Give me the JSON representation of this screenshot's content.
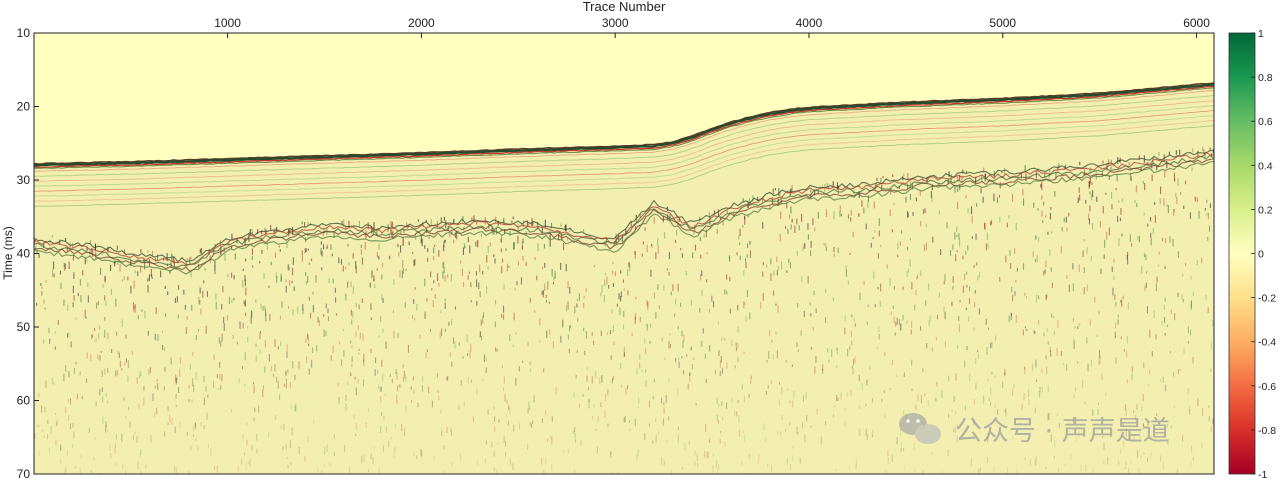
{
  "chart_data": {
    "type": "heatmap",
    "title": "",
    "xlabel": "Trace Number",
    "ylabel": "Time (ms)",
    "x_axis_position": "top",
    "x_ticks": [
      1000,
      2000,
      3000,
      4000,
      5000,
      6000
    ],
    "x_tick_labels": [
      "1000",
      "2000",
      "3000",
      "4000",
      "5000",
      "6000"
    ],
    "xlim": [
      1,
      6090
    ],
    "y_ticks": [
      10,
      20,
      30,
      40,
      50,
      60,
      70
    ],
    "y_tick_labels": [
      "10",
      "20",
      "30",
      "40",
      "50",
      "60",
      "70"
    ],
    "ylim": [
      10,
      70
    ],
    "y_direction": "reversed",
    "grid": false,
    "colorbar": {
      "position": "right",
      "range": [
        -1,
        1
      ],
      "ticks": [
        1,
        0.8,
        0.6,
        0.4,
        0.2,
        0,
        -0.2,
        -0.4,
        -0.6,
        -0.8,
        -1
      ],
      "tick_labels": [
        "1",
        "0.8",
        "0.6",
        "0.4",
        "0.2",
        "0",
        "-0.2",
        "-0.4",
        "-0.6",
        "-0.8",
        "-1"
      ],
      "colormap": [
        "#a50026",
        "#d73027",
        "#f46d43",
        "#fdae61",
        "#fee08b",
        "#ffffbf",
        "#d9ef8b",
        "#a6d96a",
        "#66bd63",
        "#1a9850",
        "#006837"
      ]
    },
    "seafloor_time_ms": {
      "trace": [
        1,
        500,
        1000,
        1500,
        2000,
        2500,
        3000,
        3200,
        3300,
        3400,
        3500,
        3600,
        3700,
        3800,
        3900,
        4000,
        4500,
        5000,
        5500,
        6090
      ],
      "time": [
        28.0,
        27.7,
        27.3,
        26.9,
        26.5,
        26.0,
        25.6,
        25.4,
        25.0,
        24.2,
        23.2,
        22.3,
        21.6,
        21.0,
        20.6,
        20.3,
        19.6,
        19.1,
        18.4,
        17.0
      ]
    },
    "reflector_top_time_ms": {
      "trace": [
        1,
        300,
        500,
        800,
        1000,
        1200,
        1500,
        1800,
        2000,
        2300,
        2600,
        2800,
        3000,
        3200,
        3400,
        3600,
        3800,
        4000,
        4300,
        4600,
        5000,
        5500,
        6090
      ],
      "time": [
        38.0,
        39.0,
        40.0,
        41.0,
        38.0,
        37.0,
        36.0,
        36.5,
        36.0,
        35.5,
        36.0,
        37.0,
        38.0,
        33.0,
        36.0,
        33.5,
        32.0,
        31.0,
        30.5,
        29.5,
        29.0,
        28.0,
        26.0
      ]
    },
    "watermark_text": "公众号 · 声声是道",
    "colors": {
      "water_column": "#ffffbf",
      "strong_positive": "#006837",
      "strong_negative": "#a50026"
    }
  }
}
